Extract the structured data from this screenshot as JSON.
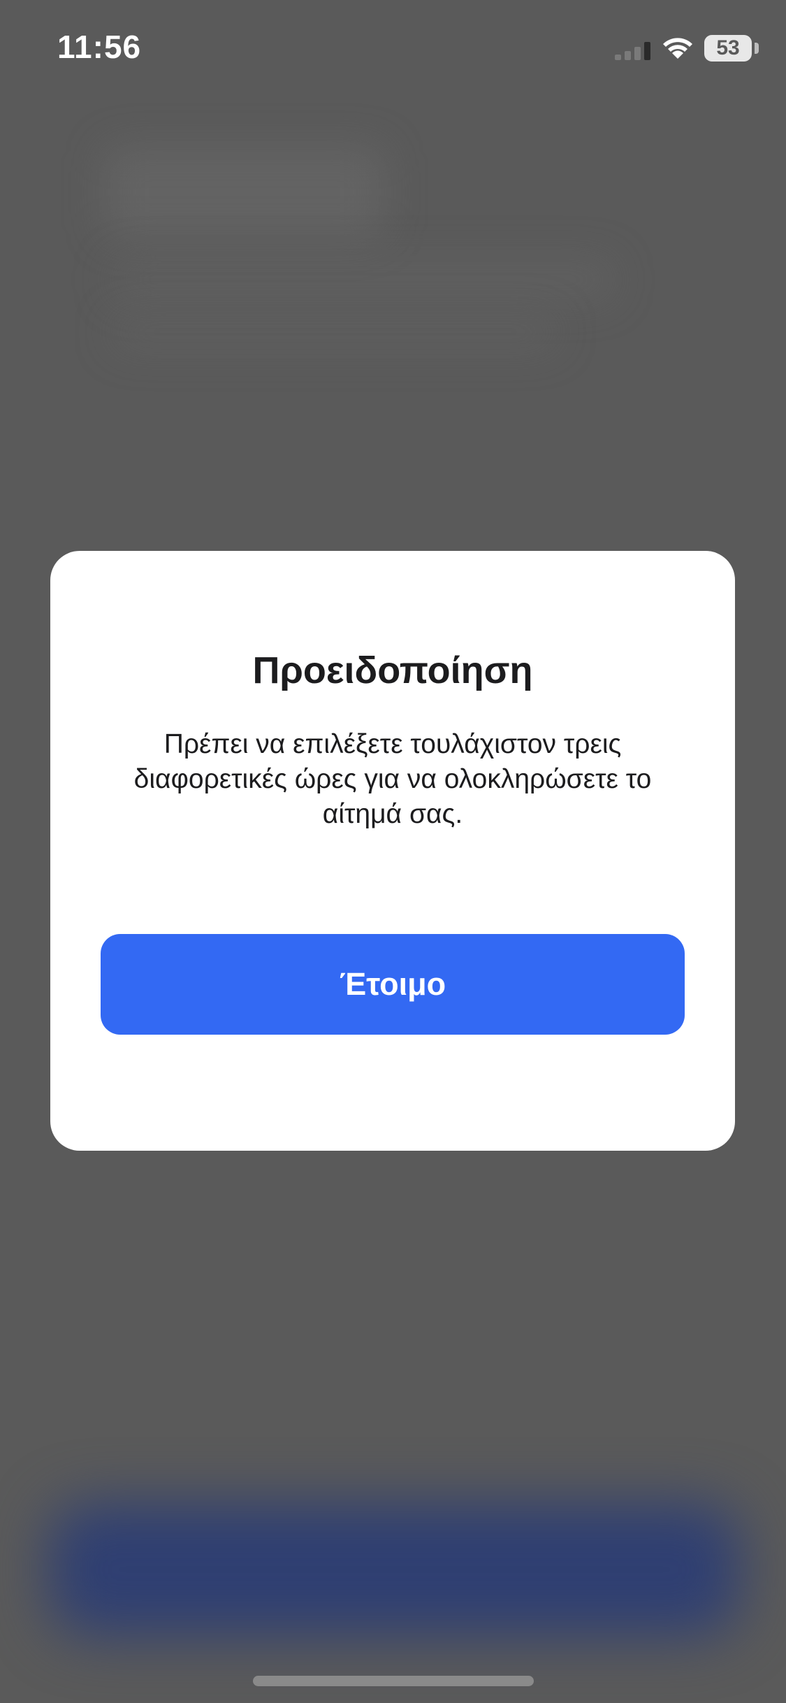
{
  "status_bar": {
    "time": "11:56",
    "battery_level": "53",
    "icons": [
      "cellular-signal-icon",
      "wifi-icon",
      "battery-icon"
    ]
  },
  "alert": {
    "title": "Προειδοποίηση",
    "message": "Πρέπει να επιλέξετε τουλάχιστον τρεις διαφορετικές ώρες για να ολοκληρώσετε το αίτημά σας.",
    "confirm_label": "Έτοιμο"
  },
  "colors": {
    "overlay": "#5a5a5a",
    "primary_button": "#3369f3",
    "modal_background": "#ffffff",
    "text": "#1c1c1e"
  }
}
